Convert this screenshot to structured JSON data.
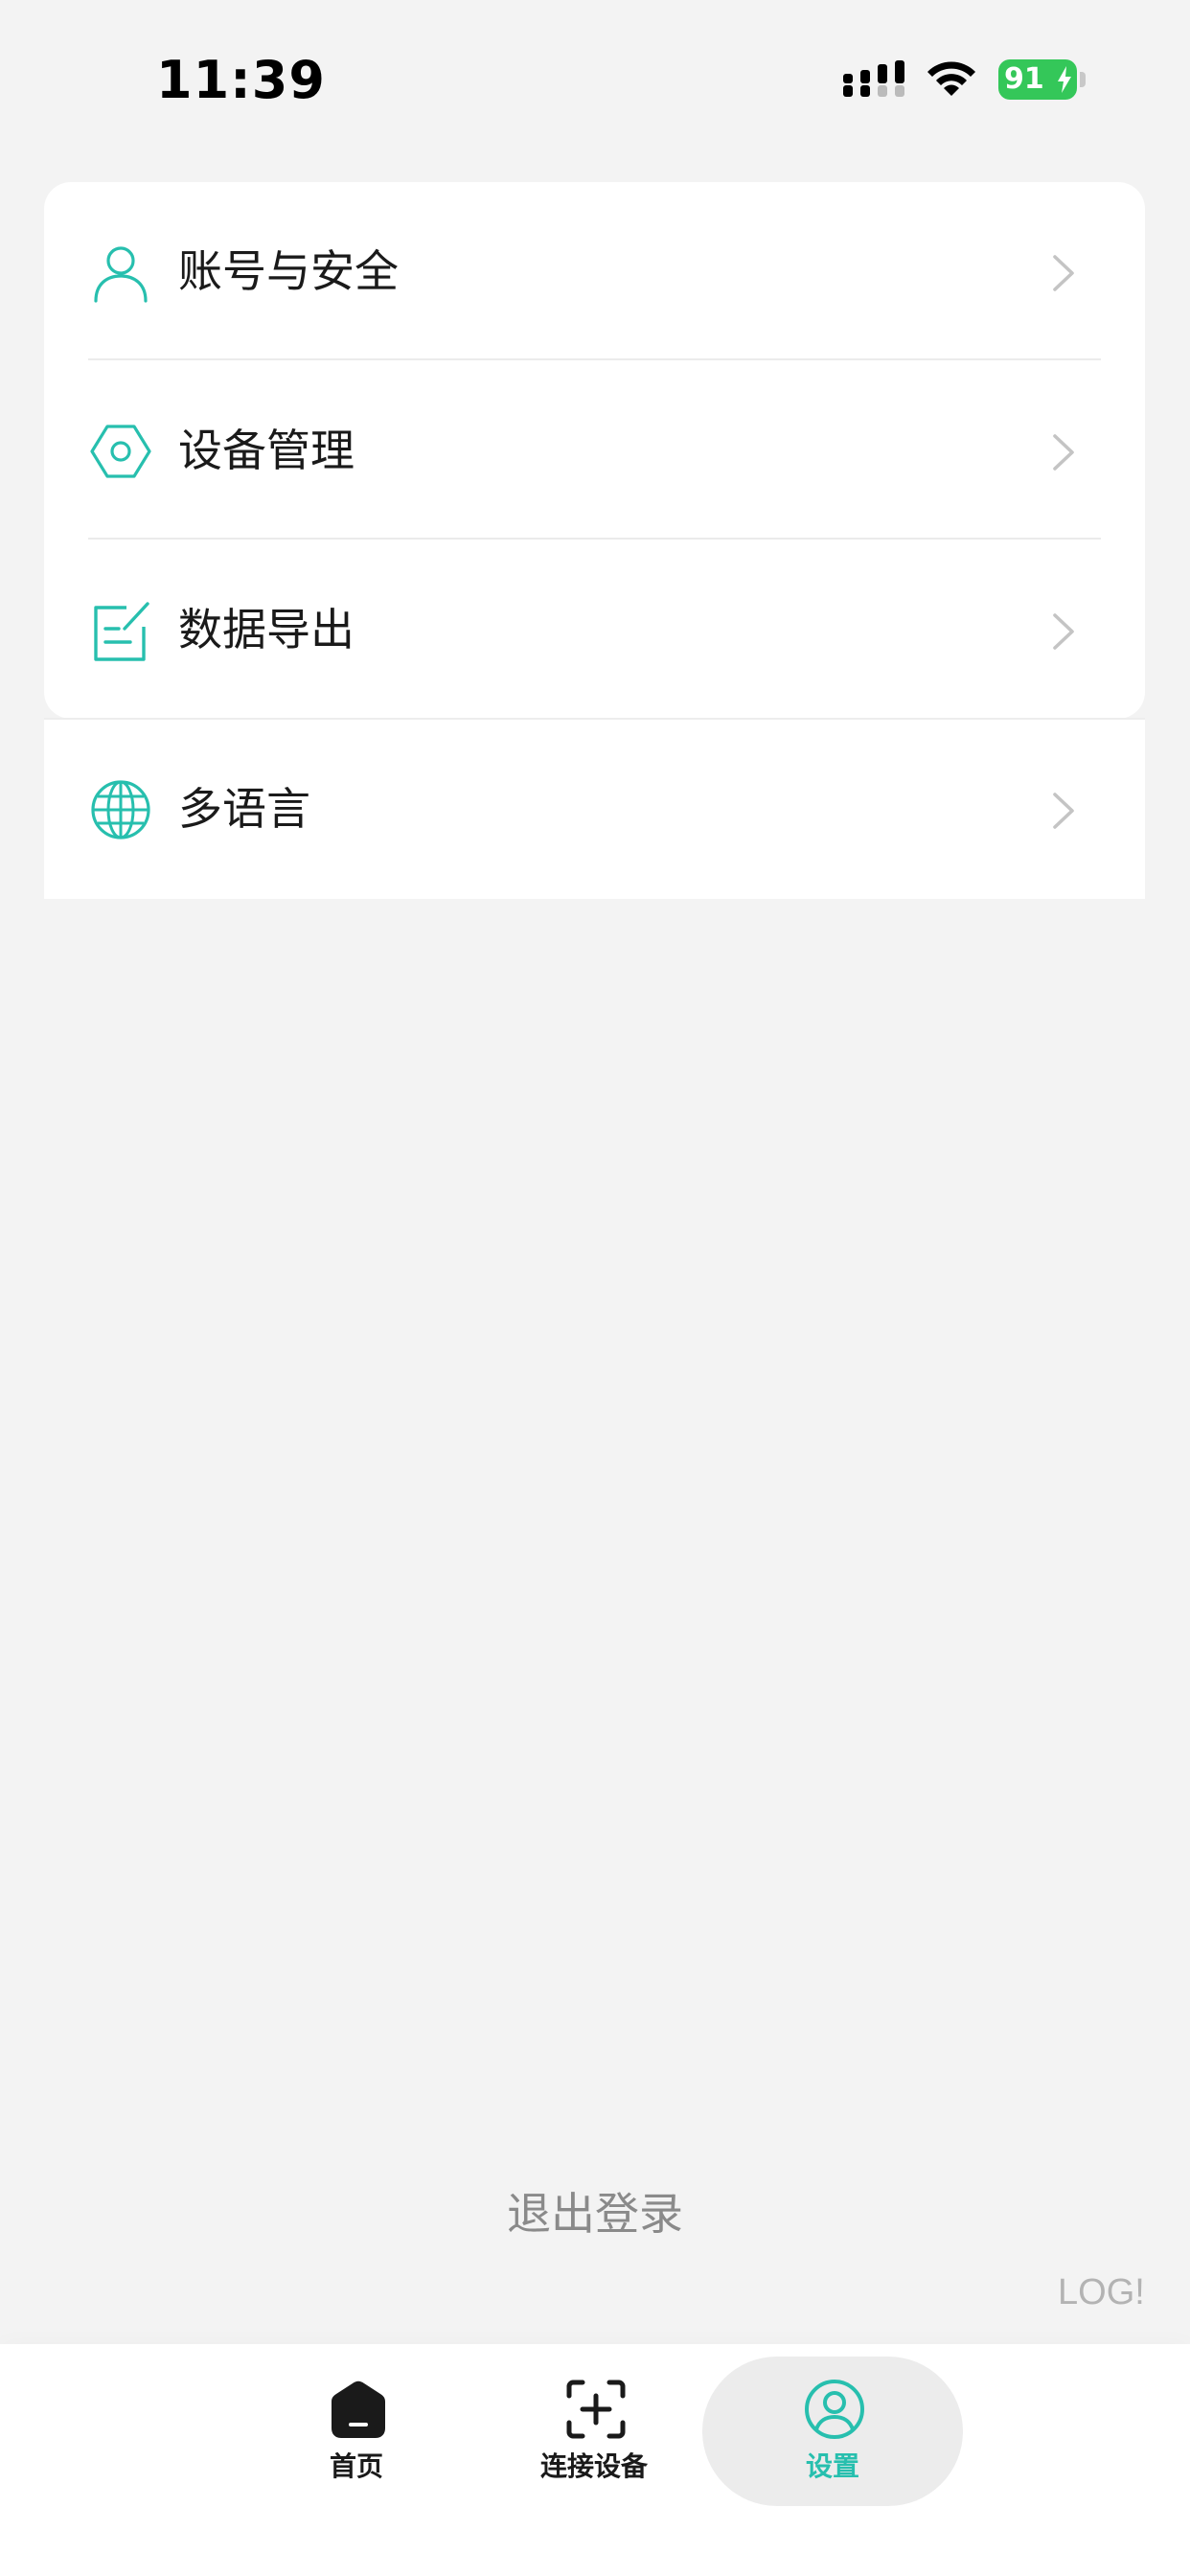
{
  "status_bar": {
    "time": "11:39",
    "battery": "91"
  },
  "menu": {
    "items": [
      {
        "label": "账号与安全",
        "icon": "user-icon"
      },
      {
        "label": "设备管理",
        "icon": "hexagon-nut-icon"
      },
      {
        "label": "数据导出",
        "icon": "edit-document-icon"
      },
      {
        "label": "多语言",
        "icon": "globe-icon"
      }
    ]
  },
  "logout_label": "退出登录",
  "log_tag": "LOG!",
  "nav": {
    "items": [
      {
        "label": "首页",
        "icon": "home-icon"
      },
      {
        "label": "连接设备",
        "icon": "scan-add-icon"
      },
      {
        "label": "设置",
        "icon": "profile-icon",
        "active": true
      }
    ]
  },
  "colors": {
    "accent": "#27bfae",
    "background": "#f3f3f3",
    "battery": "#34c759"
  }
}
